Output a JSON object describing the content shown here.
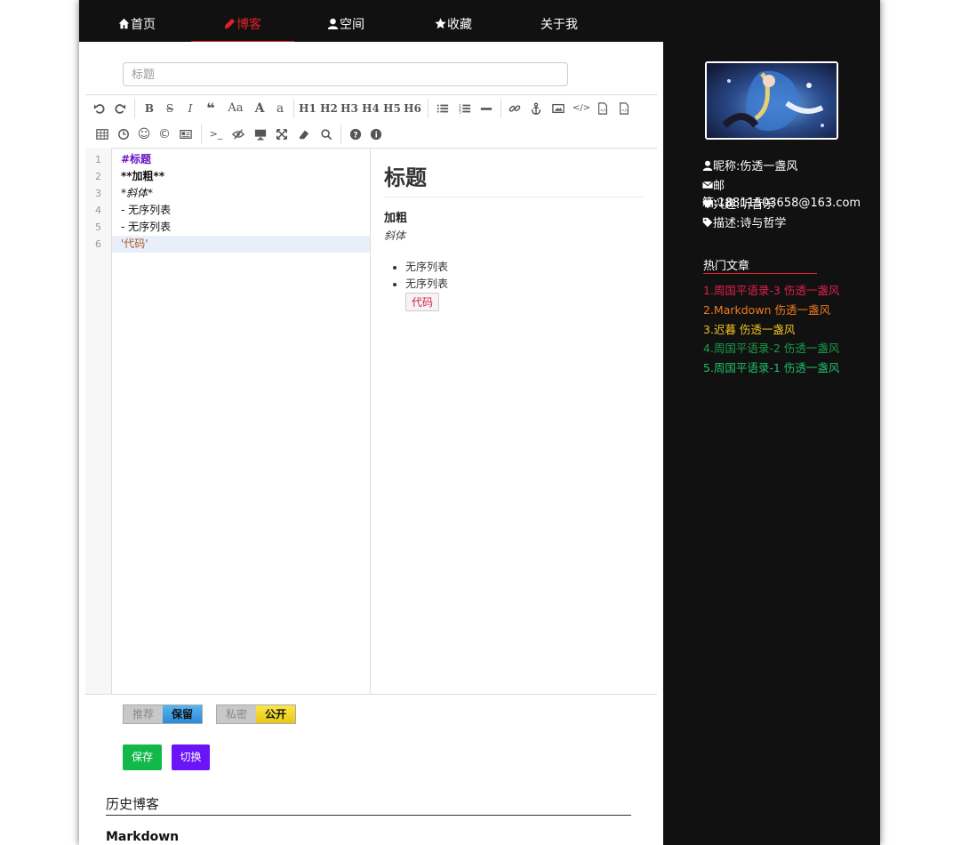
{
  "nav": {
    "items": [
      {
        "label": "首页",
        "icon": "home-icon"
      },
      {
        "label": "博客",
        "icon": "pencil-icon",
        "active": true
      },
      {
        "label": "空间",
        "icon": "user-icon"
      },
      {
        "label": "收藏",
        "icon": "star-icon"
      },
      {
        "label": "关于我"
      }
    ]
  },
  "editor": {
    "title_placeholder": "标题",
    "toolbar_headings": [
      "H1",
      "H2",
      "H3",
      "H4",
      "H5",
      "H6"
    ],
    "code_lines": [
      "#标题",
      "**加粗**",
      "*斜体*",
      "-  无序列表",
      "-  无序列表",
      "'代码'"
    ],
    "line_numbers": [
      "1",
      "2",
      "3",
      "4",
      "5",
      "6"
    ]
  },
  "preview": {
    "heading": "标题",
    "bold": "加粗",
    "italic": "斜体",
    "list": [
      "无序列表",
      "无序列表"
    ],
    "code": "代码"
  },
  "toggles": {
    "recommend_off": "推荐",
    "recommend_on": "保留",
    "private_off": "私密",
    "private_on": "公开"
  },
  "buttons": {
    "save": "保存",
    "switch": "切换"
  },
  "history": {
    "title": "历史博客",
    "first_item": "Markdown"
  },
  "sidebar": {
    "nickname": "昵称:伤透一盏风",
    "email": "邮箱:18811503658@163.com",
    "hobby": "兴趣:听音乐",
    "desc": "描述:诗与哲学",
    "hot_title": "热门文章",
    "hot": [
      {
        "text": "1.周国平语录-3 伤透一盏风",
        "color": "#e0204a"
      },
      {
        "text": "2.Markdown 伤透一盏风",
        "color": "#f07a20"
      },
      {
        "text": "3.迟暮 伤透一盏风",
        "color": "#f0c020"
      },
      {
        "text": "4.周国平语录-2 伤透一盏风",
        "color": "#1a9a4a"
      },
      {
        "text": "5.周国平语录-1 伤透一盏风",
        "color": "#1fbf6a"
      }
    ]
  },
  "colors": {
    "accent": "#e0202a",
    "save": "#12b94a",
    "switch": "#6a14f7"
  }
}
